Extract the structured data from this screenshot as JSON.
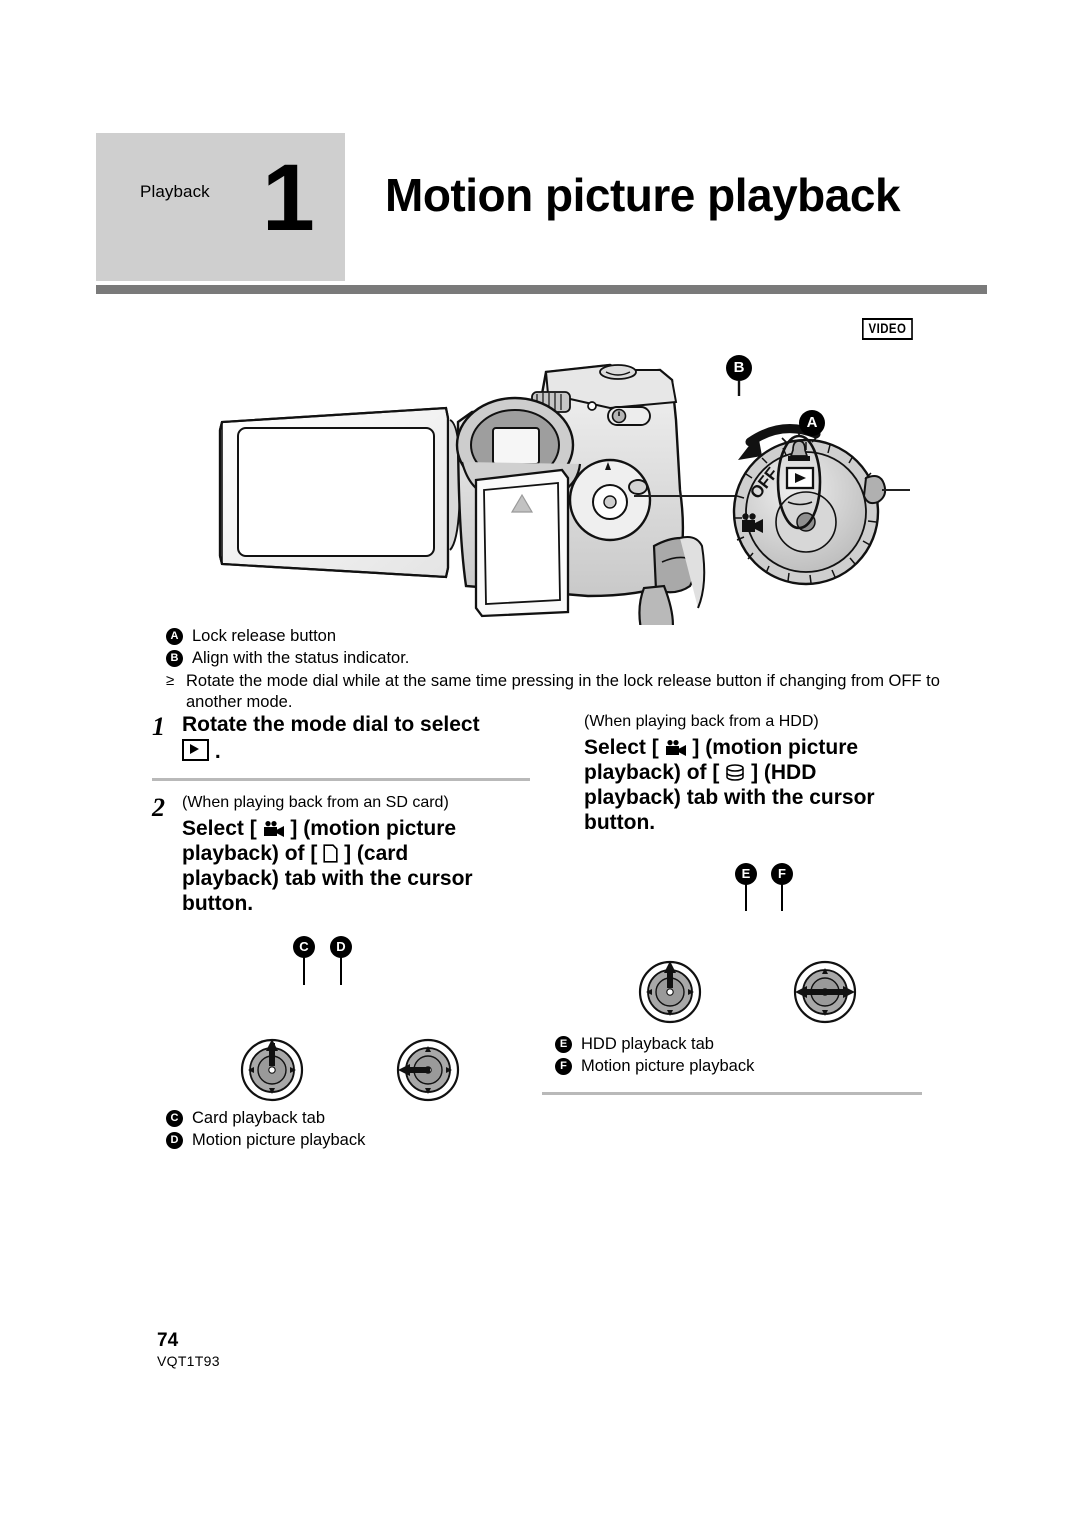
{
  "header": {
    "section_label": "Playback",
    "step_number": "1",
    "title": "Motion picture playback",
    "badge": "VIDEO"
  },
  "illustration": {
    "callouts": [
      {
        "id": "B",
        "label": "B"
      },
      {
        "id": "A",
        "label": "A"
      }
    ],
    "dial_labels": {
      "off": "OFF",
      "play_icon": "play-icon",
      "record_icon": "camcorder-icon",
      "status_lamp": "status-indicator-icon"
    }
  },
  "legend": {
    "items": [
      {
        "badge": "A",
        "text": "Lock release button"
      },
      {
        "badge": "B",
        "text": "Align with the status indicator."
      }
    ],
    "bullets": [
      {
        "marker": "≥",
        "text": "Rotate the mode dial while at the same time pressing in the lock release button if changing from OFF to another mode."
      }
    ]
  },
  "left_column": {
    "step1": {
      "number": "1",
      "text_before": "Rotate the mode dial to select",
      "icon": "play-icon",
      "text_after": "."
    },
    "step2": {
      "number": "2",
      "note": "(When playing back from an SD card)",
      "line1_a": "Select [",
      "icon1": "camcorder-icon",
      "line1_b": "] (motion picture",
      "line2_a": "playback) of [",
      "icon2": "card-icon",
      "line2_b": "] (card",
      "line3": "playback) tab with the cursor",
      "line4": "button."
    },
    "diagram_markers": [
      {
        "badge": "C"
      },
      {
        "badge": "D"
      }
    ],
    "cursor_diagrams": [
      {
        "name": "cursor-button-up",
        "direction": "up"
      },
      {
        "name": "cursor-button-left",
        "direction": "left"
      }
    ],
    "captions": [
      {
        "badge": "C",
        "text": "Card playback tab"
      },
      {
        "badge": "D",
        "text": "Motion picture playback"
      }
    ]
  },
  "right_column": {
    "note": "(When playing back from a HDD)",
    "line1_a": "Select [",
    "icon1": "camcorder-icon",
    "line1_b": "] (motion picture",
    "line2_a": "playback) of [",
    "icon2": "hdd-icon",
    "line2_b": "] (HDD",
    "line3": "playback) tab with the cursor",
    "line4": "button.",
    "diagram_markers": [
      {
        "badge": "E"
      },
      {
        "badge": "F"
      }
    ],
    "cursor_diagrams": [
      {
        "name": "cursor-button-up",
        "direction": "up"
      },
      {
        "name": "cursor-button-left-right",
        "direction": "left-right"
      }
    ],
    "captions": [
      {
        "badge": "E",
        "text": "HDD playback tab"
      },
      {
        "badge": "F",
        "text": "Motion picture playback"
      }
    ]
  },
  "footer": {
    "page_number": "74",
    "document_code": "VQT1T93"
  },
  "colors": {
    "header_block": "#cfcfcf",
    "rule": "#7a7a7a",
    "thin_rule": "#b9b9b9"
  }
}
